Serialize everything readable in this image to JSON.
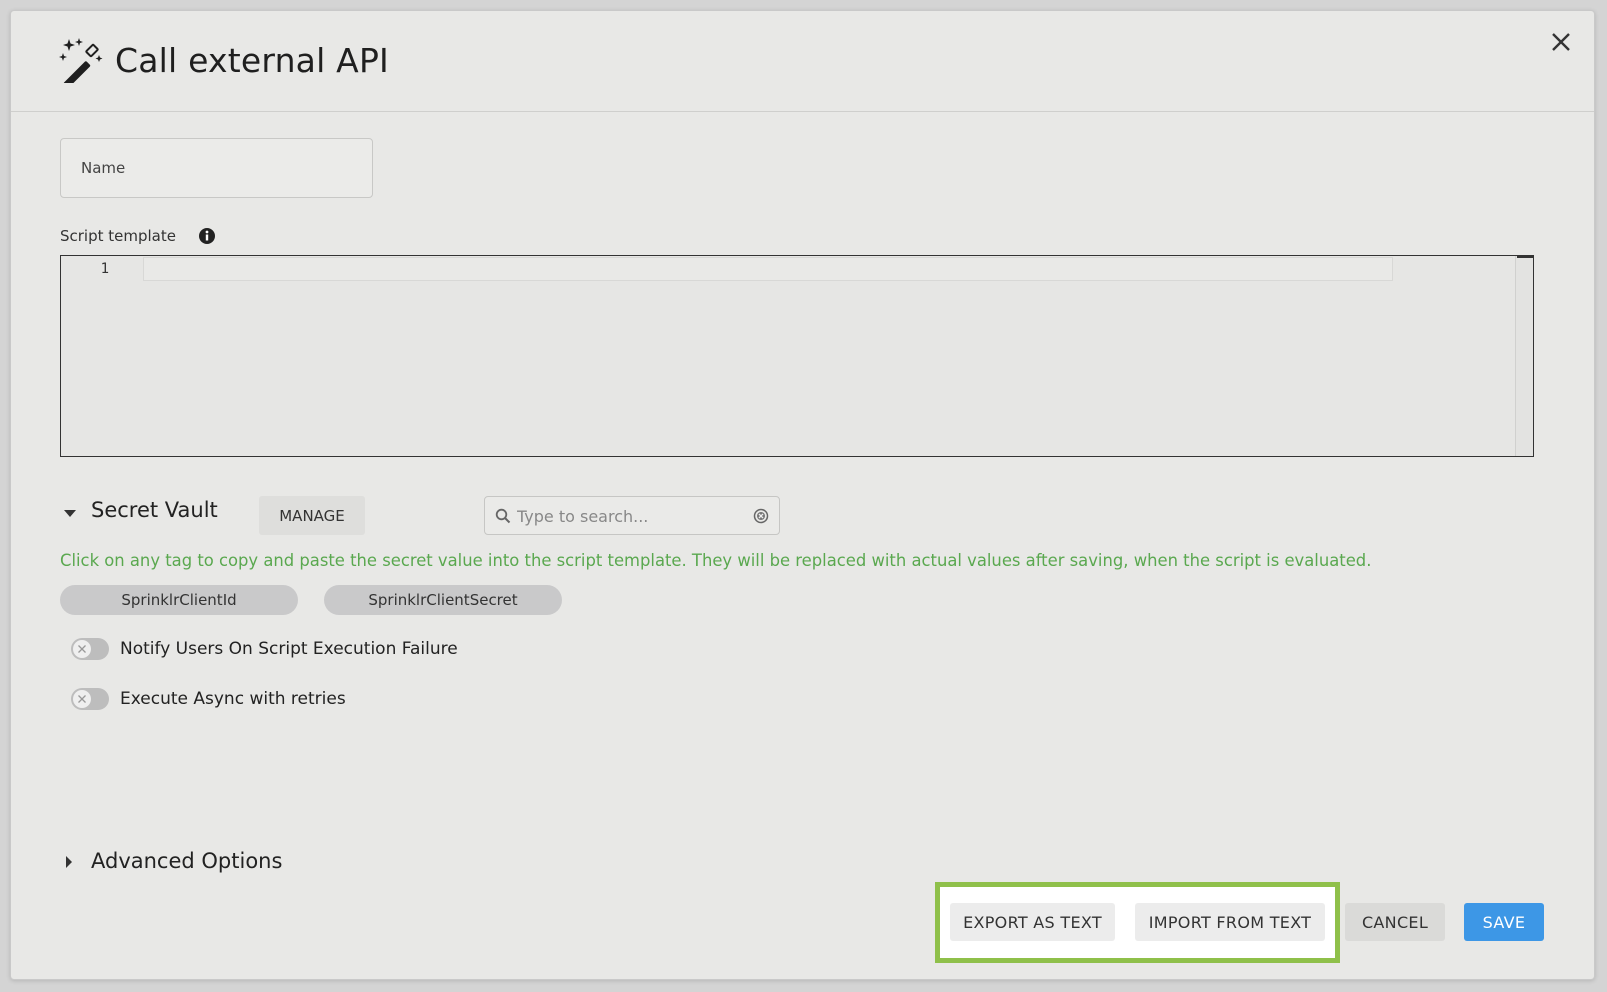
{
  "dialog": {
    "title": "Call external API",
    "title_icon": "magic-wand-icon",
    "close_icon": "close-icon"
  },
  "name_field": {
    "placeholder": "Name",
    "value": ""
  },
  "script_template": {
    "label": "Script template",
    "info_icon": "info-icon",
    "line_numbers": [
      "1"
    ],
    "code": ""
  },
  "secret_vault": {
    "title": "Secret Vault",
    "manage_label": "MANAGE",
    "search_placeholder": "Type to search...",
    "hint": "Click on any tag to copy and paste the secret value into the script template. They will be replaced with actual values after saving, when the script is evaluated.",
    "tags": [
      "SprinklrClientId",
      "SprinklrClientSecret"
    ]
  },
  "toggles": [
    {
      "label": "Notify Users On Script Execution Failure",
      "on": false
    },
    {
      "label": "Execute Async with retries",
      "on": false
    }
  ],
  "advanced": {
    "title": "Advanced Options"
  },
  "footer": {
    "export_label": "EXPORT AS TEXT",
    "import_label": "IMPORT FROM TEXT",
    "cancel_label": "CANCEL",
    "save_label": "SAVE"
  },
  "colors": {
    "hint_green": "#5aa84f",
    "save_blue": "#3d97e6",
    "highlight_green": "#8fc04a"
  }
}
